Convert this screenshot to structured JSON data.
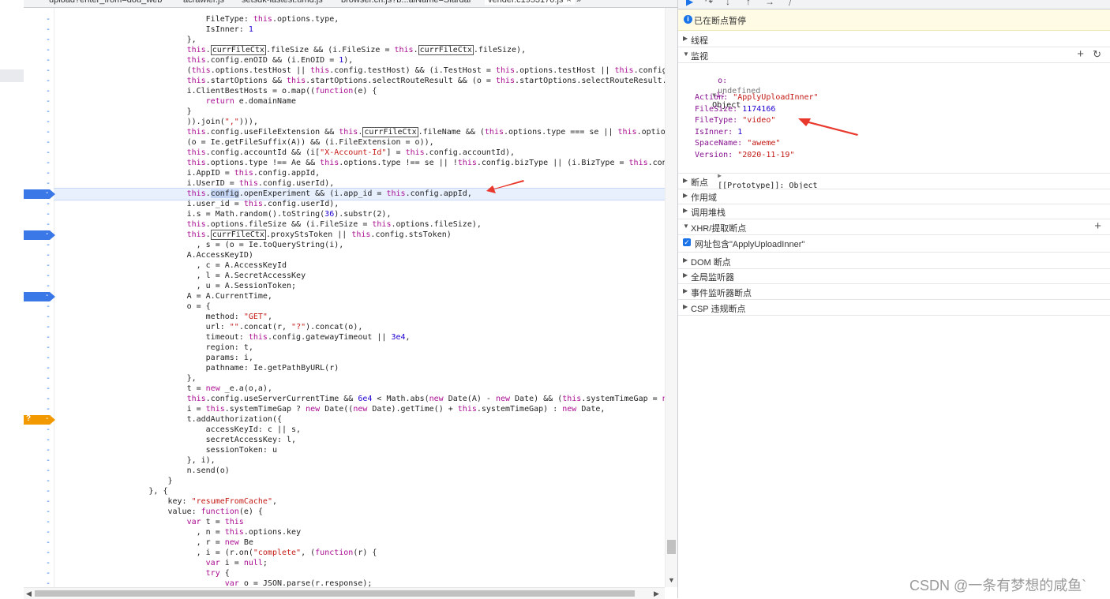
{
  "tabs": [
    {
      "label": "upload?enter_from=dou_web"
    },
    {
      "label": "acrawler.js"
    },
    {
      "label": "setsdk-lastest.umd.js"
    },
    {
      "label": "browser.cn.js?b...aiName=Slardar"
    },
    {
      "label": "vender.c1953170.js",
      "close": "×",
      "active": true
    },
    {
      "label": "»"
    }
  ],
  "code_lines": [
    {
      "text": "                                FileType: this.options.type,"
    },
    {
      "text": "                                IsInner: 1"
    },
    {
      "text": "                            },"
    },
    {
      "text": "                            this.currFileCtx.fileSize && (i.FileSize = this.currFileCtx.fileSize),"
    },
    {
      "text": "                            this.config.enOID && (i.EnOID = 1),"
    },
    {
      "text": "                            (this.options.testHost || this.config.testHost) && (i.TestHost = this.options.testHost || this.config.testHost),"
    },
    {
      "text": "                            this.startOptions && this.startOptions.selectRouteResult && (o = this.startOptions.selectRouteResult.host),"
    },
    {
      "text": "                            i.ClientBestHosts = o.map((function(e) {"
    },
    {
      "text": "                                return e.domainName"
    },
    {
      "text": "                            }"
    },
    {
      "text": "                            )).join(\",\"))),"
    },
    {
      "text": "                            this.config.useFileExtension && this.currFileCtx.fileName && (this.options.type === se || this.options.type"
    },
    {
      "text": "                            (o = Ie.getFileSuffix(A)) && (i.FileExtension = o)),"
    },
    {
      "text": "                            this.config.accountId && (i[\"X-Account-Id\"] = this.config.accountId),"
    },
    {
      "text": "                            this.options.type !== Ae && this.options.type !== se || !this.config.bizType || (i.BizType = this.config.bizType),"
    },
    {
      "text": "                            i.AppID = this.config.appId,"
    },
    {
      "text": "                            i.UserID = this.config.userId),"
    },
    {
      "text": "                            this.config.openExperiment && (i.app_id = this.config.appId,"
    },
    {
      "text": "                            i.user_id = this.config.userId),"
    },
    {
      "text": "                            i.s = Math.random().toString(36).substr(2),"
    },
    {
      "text": "                            this.options.fileSize && (i.FileSize = this.options.fileSize),"
    },
    {
      "text": "                            this.currFileCtx.proxyStsToken || this.config.stsToken)"
    },
    {
      "text": "                              , s = (o = Ie.toQueryString(i),"
    },
    {
      "text": "                            A.AccessKeyID)"
    },
    {
      "text": "                              , c = A.AccessKeyId"
    },
    {
      "text": "                              , l = A.SecretAccessKey"
    },
    {
      "text": "                              , u = A.SessionToken;"
    },
    {
      "text": "                            A = A.CurrentTime,"
    },
    {
      "text": "                            o = {"
    },
    {
      "text": "                                method: \"GET\","
    },
    {
      "text": "                                url: \"\".concat(r, \"?\").concat(o),"
    },
    {
      "text": "                                timeout: this.config.gatewayTimeout || 3e4,"
    },
    {
      "text": "                                region: t,"
    },
    {
      "text": "                                params: i,"
    },
    {
      "text": "                                pathname: Ie.getPathByURL(r)"
    },
    {
      "text": "                            },"
    },
    {
      "text": "                            t = new _e.a(o,a),"
    },
    {
      "text": "                            this.config.useServerCurrentTime && 6e4 < Math.abs(new Date(A) - new Date) && (this.systemTimeGap = new Date(A)"
    },
    {
      "text": "                            i = this.systemTimeGap ? new Date((new Date).getTime() + this.systemTimeGap) : new Date,"
    },
    {
      "text": "                            t.addAuthorization({"
    },
    {
      "text": "                                accessKeyId: c || s,"
    },
    {
      "text": "                                secretAccessKey: l,"
    },
    {
      "text": "                                sessionToken: u"
    },
    {
      "text": "                            }, i),"
    },
    {
      "text": "                            n.send(o)"
    },
    {
      "text": "                        }"
    },
    {
      "text": "                    }, {"
    },
    {
      "text": "                        key: \"resumeFromCache\","
    },
    {
      "text": "                        value: function(e) {"
    },
    {
      "text": "                            var t = this"
    },
    {
      "text": "                              , n = this.options.key"
    },
    {
      "text": "                              , r = new Be"
    },
    {
      "text": "                              , i = (r.on(\"complete\", (function(r) {"
    },
    {
      "text": "                                var i = null;"
    },
    {
      "text": "                                try {"
    },
    {
      "text": "                                    var o = JSON.parse(r.response);"
    }
  ],
  "gutter_marker": "-",
  "cond_marker": "?",
  "right_panel": {
    "paused_banner": "已在断点暂停",
    "info_glyph": "i",
    "sections": {
      "threads": "线程",
      "watch": "监视",
      "breakpoints": "断点",
      "scope": "作用域",
      "call_stack": "调用堆栈",
      "xhr": "XHR/提取断点",
      "dom": "DOM 断点",
      "global": "全局监听器",
      "event": "事件监听器断点",
      "csp": "CSP 违规断点"
    },
    "plus": "+",
    "refresh": "↻",
    "watch_items": {
      "o_key": "o:",
      "o_val": "undefined",
      "i_key": "i:",
      "i_val": "Object",
      "props": [
        {
          "key": "Action:",
          "val": "\"ApplyUploadInner\"",
          "kind": "str"
        },
        {
          "key": "FileSize:",
          "val": "1174166",
          "kind": "num"
        },
        {
          "key": "FileType:",
          "val": "\"video\"",
          "kind": "str"
        },
        {
          "key": "IsInner:",
          "val": "1",
          "kind": "num"
        },
        {
          "key": "SpaceName:",
          "val": "\"aweme\"",
          "kind": "str"
        },
        {
          "key": "Version:",
          "val": "\"2020-11-19\"",
          "kind": "str"
        }
      ],
      "proto": "[[Prototype]]: Object"
    },
    "xhr_item": "网址包含\"ApplyUploadInner\"",
    "check": "✓"
  },
  "watermark": "CSDN @一条有梦想的咸鱼`",
  "colors": {
    "keyword": "#aa0d91",
    "string": "#c41a16",
    "number": "#1c00cf",
    "breakpoint": "#3b78e7",
    "conditional": "#f29900",
    "arrow": "#e8392c"
  }
}
